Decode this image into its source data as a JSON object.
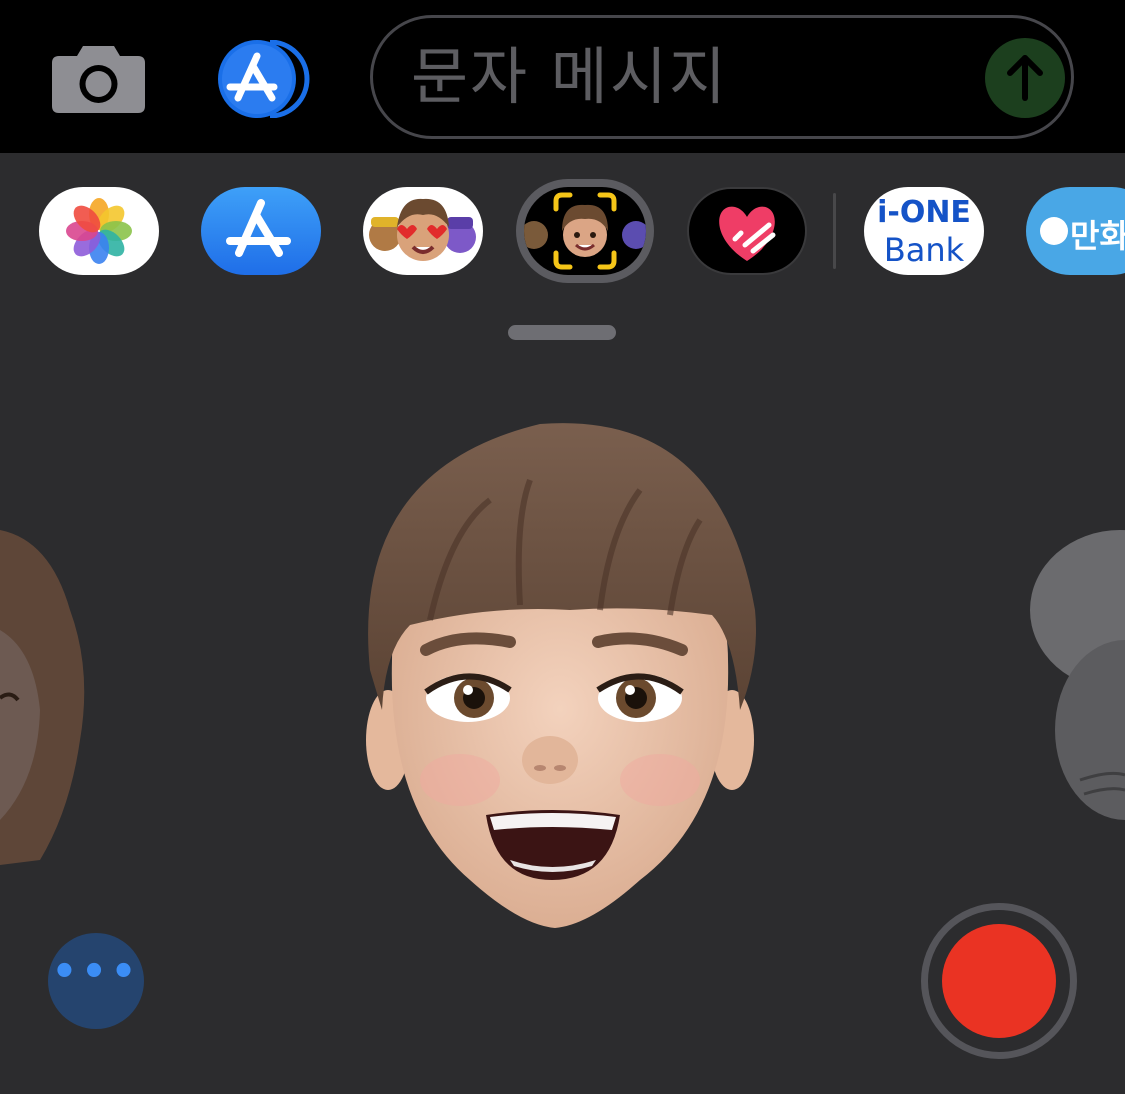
{
  "compose": {
    "camera_icon": "camera-icon",
    "appstore_icon": "app-store-icon",
    "placeholder": "문자 메시지",
    "send_icon": "arrow-up-icon"
  },
  "app_drawer": {
    "apps": [
      {
        "id": "photos",
        "icon": "photos-icon"
      },
      {
        "id": "app-store",
        "icon": "app-store-icon"
      },
      {
        "id": "memoji-stickers",
        "icon": "memoji-stickers-icon"
      },
      {
        "id": "memoji",
        "icon": "memoji-icon",
        "selected": true
      },
      {
        "id": "heart-app",
        "icon": "heart-icon"
      },
      {
        "id": "ione-bank",
        "line1": "i-ONE",
        "line2": "Bank"
      },
      {
        "id": "manhwa",
        "label": "만화경"
      }
    ]
  },
  "controls": {
    "more_label": "•••",
    "record_icon": "record-icon"
  },
  "colors": {
    "background": "#2c2c2e",
    "topbar": "#000000",
    "accent_blue": "#0a84ff",
    "record_red": "#ea3323",
    "send_green": "#1c3f1e"
  }
}
